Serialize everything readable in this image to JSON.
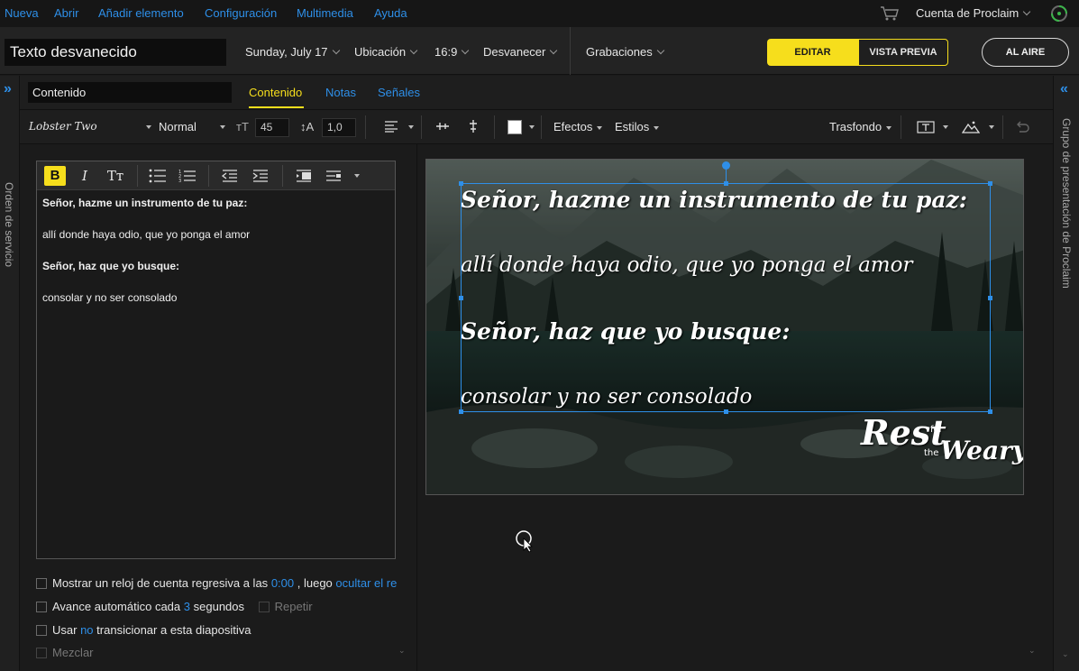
{
  "menu": {
    "items": [
      "Nueva",
      "Abrir",
      "Añadir elemento",
      "Configuración",
      "Multimedia",
      "Ayuda"
    ],
    "account_label": "Cuenta de Proclaim"
  },
  "header": {
    "title_value": "Texto desvanecido",
    "date": "Sunday, July 17",
    "location": "Ubicación",
    "aspect": "16:9",
    "transition": "Desvanecer",
    "recordings": "Grabaciones",
    "edit_label": "EDITAR",
    "preview_label": "VISTA PREVIA",
    "live_label": "AL AIRE"
  },
  "rails": {
    "left_label": "Orden de servicio",
    "right_label": "Grupo de presentación de Proclaim"
  },
  "tabs": {
    "slide_name_value": "Contenido",
    "items": [
      "Contenido",
      "Notas",
      "Señales"
    ],
    "active": "Contenido"
  },
  "format": {
    "font": "Lobster Two",
    "weight": "Normal",
    "size": "45",
    "line_height": "1,0",
    "effects": "Efectos",
    "styles": "Estilos",
    "background": "Trasfondo"
  },
  "editor": {
    "bold": "B",
    "italic": "I",
    "textsize": "Tт",
    "lines": [
      "Señor,  hazme un instrumento de tu paz:",
      "allí donde haya odio, que yo ponga el amor",
      "Señor, haz que yo busque:",
      "consolar y no ser consolado"
    ]
  },
  "options": {
    "countdown_pre": "Mostrar un reloj de cuenta regresiva a las",
    "countdown_time": "0:00",
    "countdown_mid": ", luego",
    "countdown_link": "ocultar el re",
    "autoadvance_pre": "Avance automático cada",
    "autoadvance_num": "3",
    "autoadvance_post": "segundos",
    "repeat": "Repetir",
    "transition_pre": "Usar",
    "transition_link": "no",
    "transition_post": "transicionar a esta diapositiva",
    "shuffle": "Mezclar"
  },
  "slide": {
    "lines": [
      "Señor,  hazme un instrumento de tu paz:",
      "allí donde haya odio, que yo ponga el amor",
      "Señor, haz que yo busque:",
      "consolar y no ser consolado"
    ],
    "logo_text": "Rest for the Weary"
  },
  "colors": {
    "accent": "#f6de1c",
    "link": "#2e8fe8",
    "selection": "#2e8fe8"
  }
}
